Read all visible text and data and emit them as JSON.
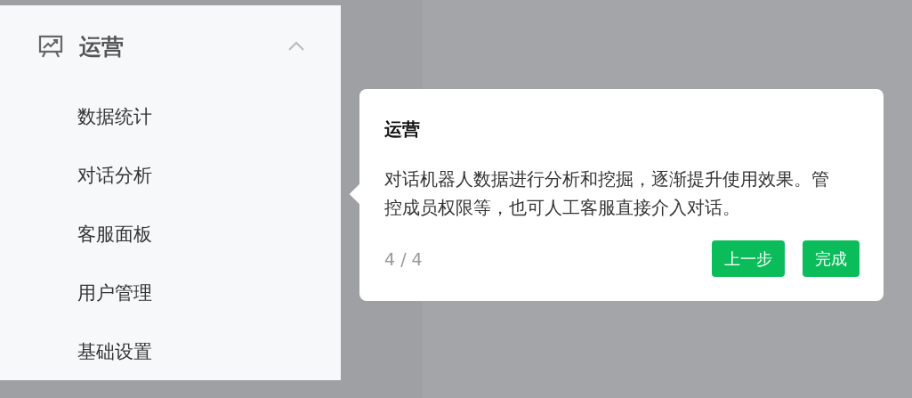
{
  "menu": {
    "title": "运营",
    "expanded": true,
    "items": [
      "数据统计",
      "对话分析",
      "客服面板",
      "用户管理",
      "基础设置"
    ]
  },
  "guide": {
    "title": "运营",
    "description": "对话机器人数据进行分析和挖掘，逐渐提升使用效果。管控成员权限等，也可人工客服直接介入对话。",
    "step": "4 / 4",
    "buttons": [
      "上一步",
      "完成"
    ]
  }
}
